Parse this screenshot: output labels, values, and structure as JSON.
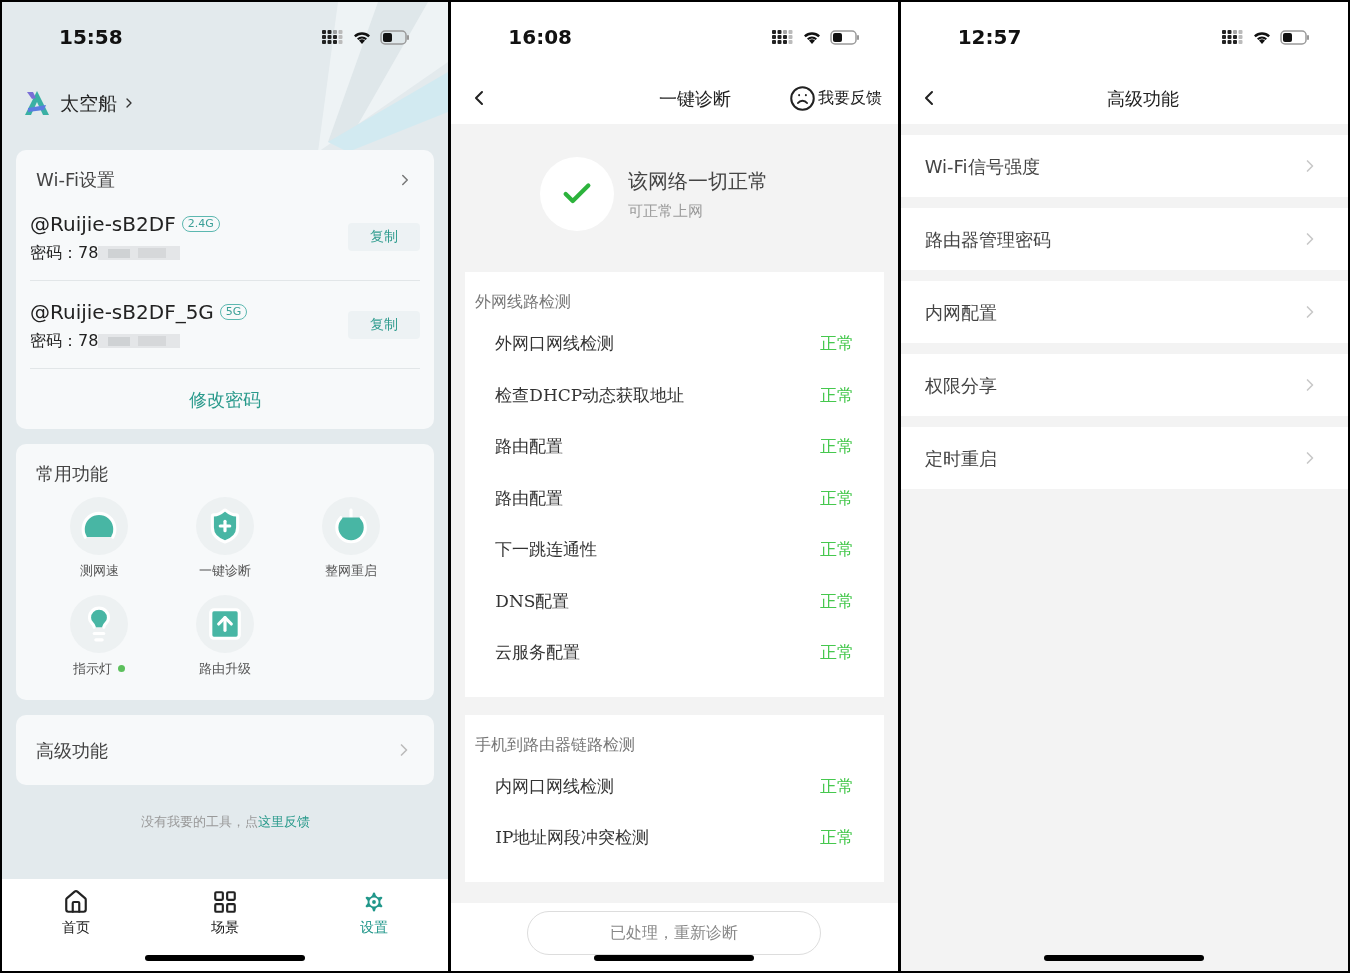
{
  "home_screen": {
    "status_bar": {
      "time": "15:58"
    },
    "account": {
      "name": "太空船"
    },
    "wifi_card": {
      "title": "Wi-Fi设置",
      "networks": [
        {
          "ssid": "@Ruijie-sB2DF",
          "band": "2.4G",
          "password": "密码：78",
          "copy_label": "复制"
        },
        {
          "ssid": "@Ruijie-sB2DF_5G",
          "band": "5G",
          "password": "密码：78",
          "copy_label": "复制"
        }
      ],
      "change_password": "修改密码"
    },
    "common_functions": {
      "title": "常用功能",
      "items": [
        {
          "kind": "speed",
          "label": "测网速"
        },
        {
          "kind": "diagnose",
          "label": "一键诊断"
        },
        {
          "kind": "restart",
          "label": "整网重启"
        },
        {
          "kind": "light",
          "label": "指示灯",
          "color": "#5cc05c"
        },
        {
          "kind": "upgrade",
          "label": "路由升级"
        }
      ]
    },
    "advanced": {
      "title": "高级功能"
    },
    "feedback": {
      "text": "没有我要的工具，点",
      "link": "这里反馈"
    },
    "tab_bar": [
      {
        "kind": "home",
        "label": "首页",
        "selected": false
      },
      {
        "kind": "scenes",
        "label": "场景",
        "selected": false
      },
      {
        "kind": "settings",
        "label": "设置",
        "selected": true
      }
    ]
  },
  "diagnosis_screen": {
    "status_bar": {
      "time": "16:08"
    },
    "nav": {
      "title": "一键诊断",
      "feedback": "我要反馈"
    },
    "result": {
      "title": "该网络一切正常",
      "subtitle": "可正常上网"
    },
    "sections": [
      {
        "title": "外网线路检测",
        "checks": [
          {
            "label": "外网口网线检测",
            "status": "正常"
          },
          {
            "label": "检查DHCP动态获取地址",
            "status": "正常"
          },
          {
            "label": "路由配置",
            "status": "正常"
          },
          {
            "label": "路由配置",
            "status": "正常"
          },
          {
            "label": "下一跳连通性",
            "status": "正常"
          },
          {
            "label": "DNS配置",
            "status": "正常"
          },
          {
            "label": "云服务配置",
            "status": "正常"
          }
        ]
      },
      {
        "title": "手机到路由器链路检测",
        "checks": [
          {
            "label": "内网口网线检测",
            "status": "正常"
          },
          {
            "label": "IP地址网段冲突检测",
            "status": "正常"
          }
        ]
      }
    ],
    "recheck_button": "已处理，重新诊断"
  },
  "advanced_screen": {
    "status_bar": {
      "time": "12:57"
    },
    "nav": {
      "title": "高级功能"
    },
    "items": [
      {
        "label": "Wi-Fi信号强度"
      },
      {
        "label": "路由器管理密码"
      },
      {
        "label": "内网配置"
      },
      {
        "label": "权限分享"
      },
      {
        "label": "定时重启"
      }
    ]
  }
}
